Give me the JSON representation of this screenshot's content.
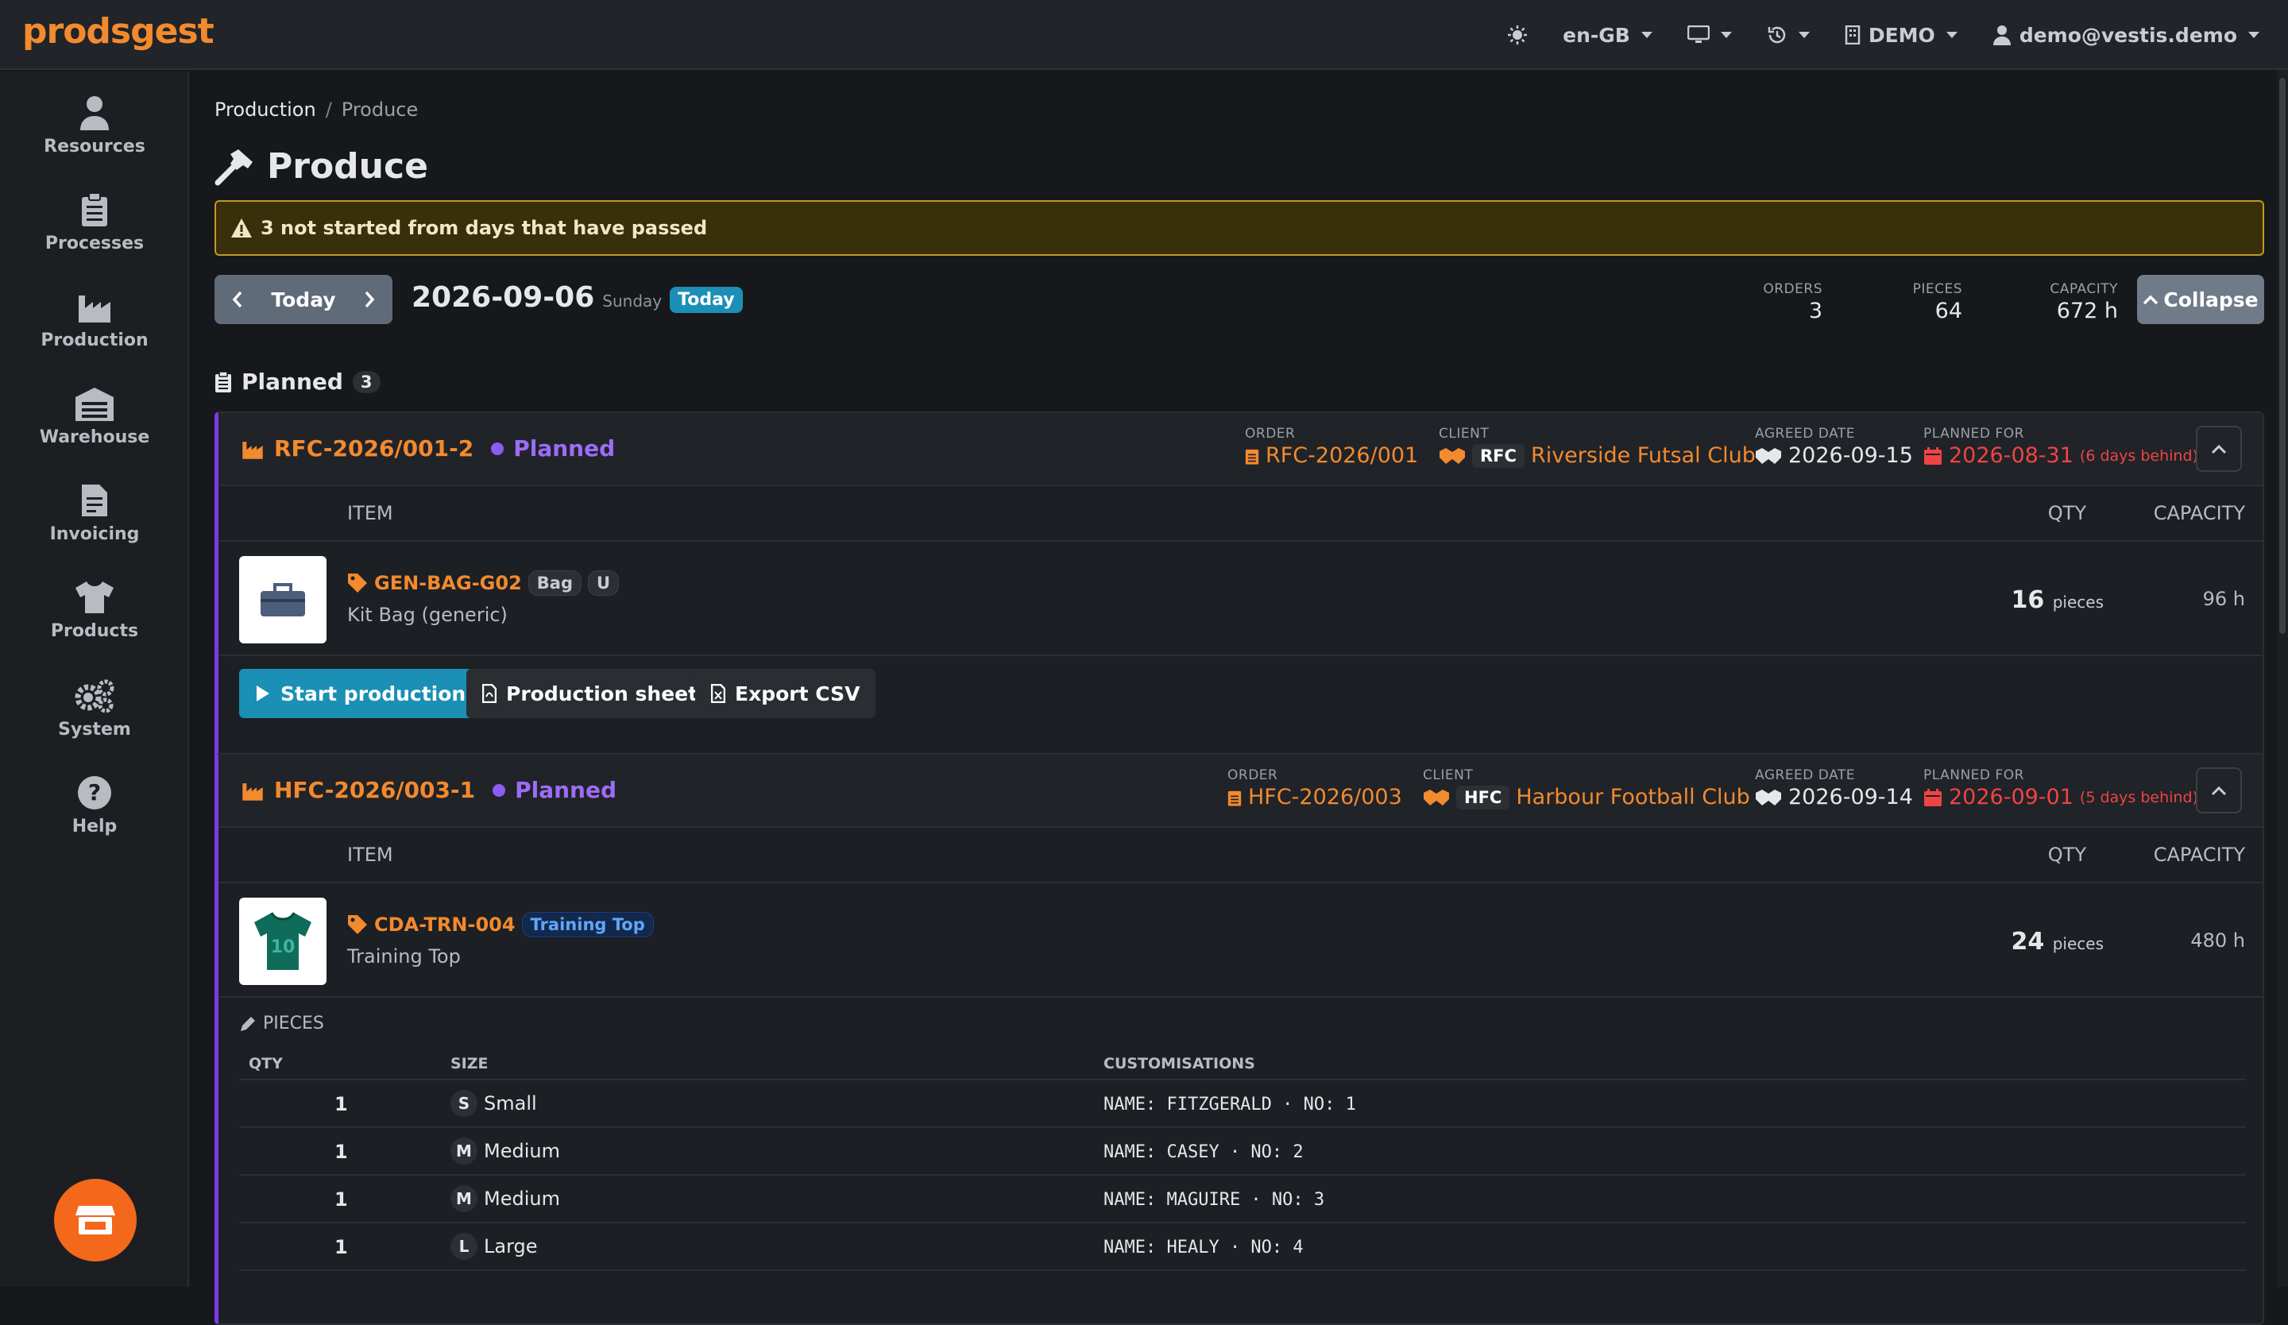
{
  "app": {
    "logo": "prodsgest"
  },
  "topnav": {
    "language": "en-GB",
    "company": "DEMO",
    "user": "demo@vestis.demo"
  },
  "sidebar": {
    "items": [
      {
        "label": "Resources",
        "icon": "user-icon"
      },
      {
        "label": "Processes",
        "icon": "clipboard-icon"
      },
      {
        "label": "Production",
        "icon": "factory-icon"
      },
      {
        "label": "Warehouse",
        "icon": "warehouse-icon"
      },
      {
        "label": "Invoicing",
        "icon": "invoice-icon"
      },
      {
        "label": "Products",
        "icon": "shirt-icon"
      },
      {
        "label": "System",
        "icon": "gears-icon"
      },
      {
        "label": "Help",
        "icon": "question-icon"
      }
    ]
  },
  "breadcrumb": {
    "parent": "Production",
    "separator": "/",
    "current": "Produce"
  },
  "page": {
    "title": "Produce"
  },
  "alert": {
    "text": "3 not started from days that have passed"
  },
  "datebar": {
    "today_button": "Today",
    "date": "2026-09-06",
    "weekday": "Sunday",
    "today_badge": "Today",
    "stats": {
      "orders_label": "ORDERS",
      "orders_value": "3",
      "pieces_label": "PIECES",
      "pieces_value": "64",
      "capacity_label": "CAPACITY",
      "capacity_value": "672 h"
    },
    "collapse_button": "Collapse"
  },
  "section": {
    "title": "Planned",
    "count": "3"
  },
  "labels": {
    "order": "ORDER",
    "client": "CLIENT",
    "agreed_date": "AGREED DATE",
    "planned_for": "PLANNED FOR",
    "item": "ITEM",
    "qty": "QTY",
    "capacity": "CAPACITY",
    "pieces_unit": "pieces"
  },
  "cards": [
    {
      "id": "RFC-2026/001-2",
      "status": "Planned",
      "order": "RFC-2026/001",
      "client_abbr": "RFC",
      "client_name": "Riverside Futsal Club",
      "agreed_date": "2026-09-15",
      "planned_for": "2026-08-31",
      "behind": "(6 days behind)",
      "item": {
        "code": "GEN-BAG-G02",
        "tag1": "Bag",
        "tag2": "U",
        "name": "Kit Bag (generic)",
        "qty": "16",
        "capacity": "96 h"
      },
      "actions": {
        "start": "Start production",
        "sheet": "Production sheet",
        "csv": "Export CSV"
      }
    },
    {
      "id": "HFC-2026/003-1",
      "status": "Planned",
      "order": "HFC-2026/003",
      "client_abbr": "HFC",
      "client_name": "Harbour Football Club",
      "agreed_date": "2026-09-14",
      "planned_for": "2026-09-01",
      "behind": "(5 days behind)",
      "item": {
        "code": "CDA-TRN-004",
        "tag1": "Training Top",
        "name": "Training Top",
        "qty": "24",
        "capacity": "480 h"
      },
      "pieces": {
        "label": "PIECES",
        "headers": {
          "qty": "QTY",
          "size": "SIZE",
          "customisations": "CUSTOMISATIONS"
        },
        "rows": [
          {
            "qty": "1",
            "size_code": "S",
            "size": "Small",
            "custom": "NAME: FITZGERALD · NO: 1"
          },
          {
            "qty": "1",
            "size_code": "M",
            "size": "Medium",
            "custom": "NAME: CASEY · NO: 2"
          },
          {
            "qty": "1",
            "size_code": "M",
            "size": "Medium",
            "custom": "NAME: MAGUIRE · NO: 3"
          },
          {
            "qty": "1",
            "size_code": "L",
            "size": "Large",
            "custom": "NAME: HEALY · NO: 4"
          }
        ]
      }
    }
  ],
  "colors": {
    "accent": "#f28a2e",
    "planned": "#8b5cf6",
    "danger": "#ef4444",
    "teal": "#1b8fb5",
    "warning_border": "#c19a1a"
  }
}
